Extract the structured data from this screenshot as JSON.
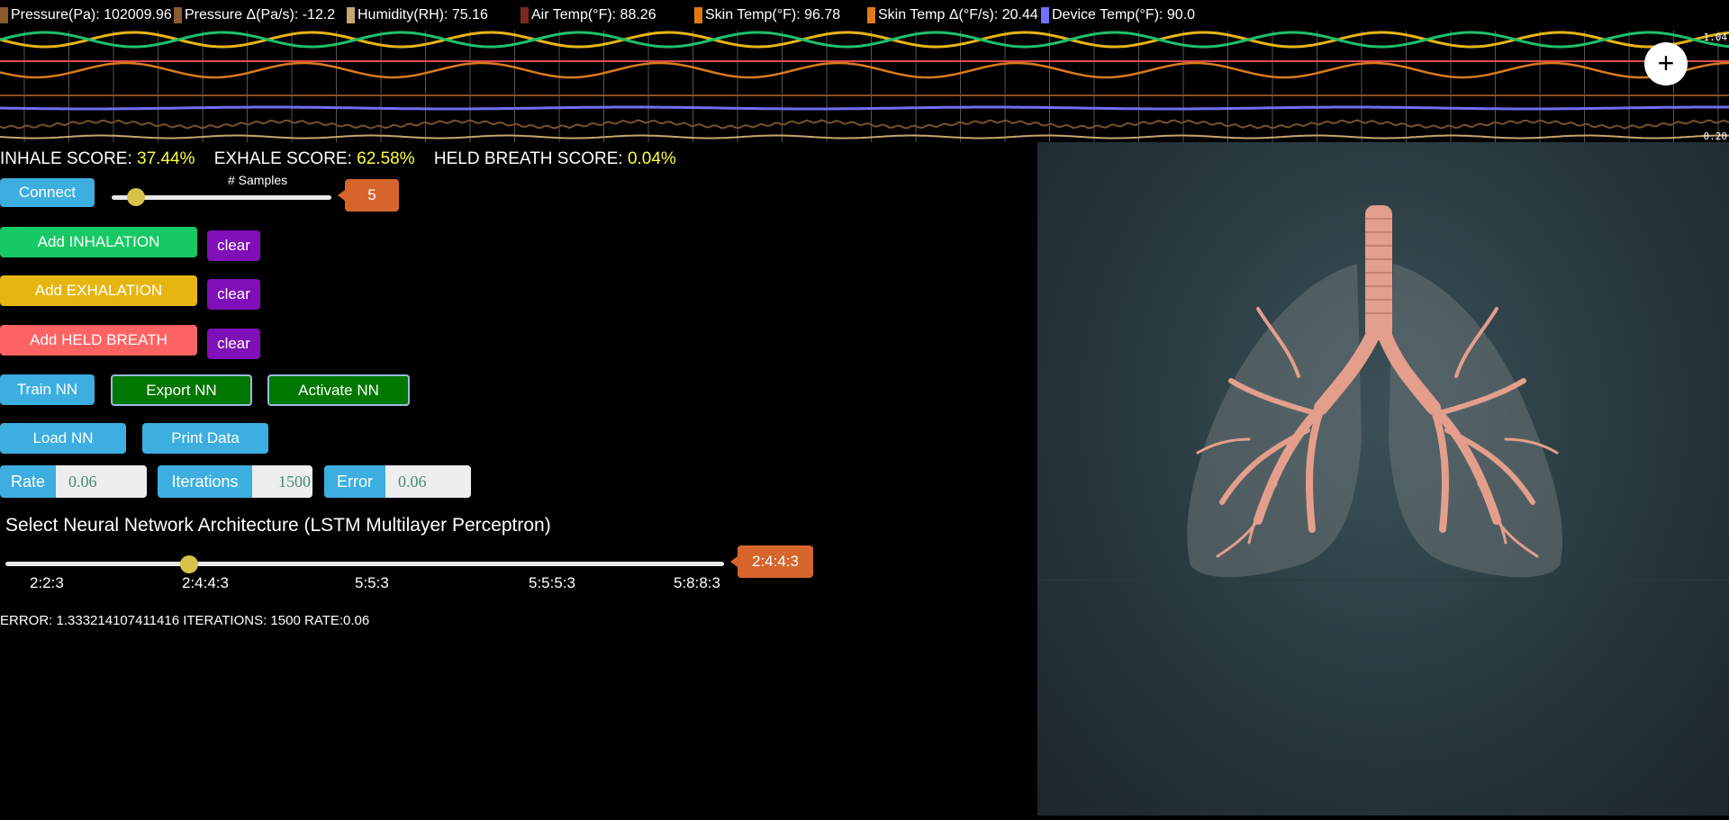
{
  "legend": [
    {
      "label": "Pressure(Pa): 102009.96",
      "color": "#8a5a2c"
    },
    {
      "label": "Pressure Δ(Pa/s): -12.2",
      "color": "#8c5a2b"
    },
    {
      "label": "Humidity(RH): 75.16",
      "color": "#c8a56e"
    },
    {
      "label": "Air Temp(°F): 88.26",
      "color": "#7a2a1a"
    },
    {
      "label": "Skin Temp(°F): 96.78",
      "color": "#e07a10"
    },
    {
      "label": "Skin Temp Δ(°F/s): 20.44",
      "color": "#e0781c"
    },
    {
      "label": "Device Temp(°F): 90.0",
      "color": "#7070ff"
    }
  ],
  "chart": {
    "ymax_label": "1.04",
    "ymin_label": "0.20"
  },
  "zoom_button": "+",
  "scores": {
    "inhale_label": "INHALE SCORE:",
    "inhale_value": "37.44%",
    "exhale_label": "EXHALE SCORE:",
    "exhale_value": "62.58%",
    "held_label": "HELD BREATH SCORE:",
    "held_value": "0.04%"
  },
  "controls": {
    "connect": "Connect",
    "samples_label": "# Samples",
    "samples_value": "5",
    "add_inhalation": "Add INHALATION",
    "add_exhalation": "Add EXHALATION",
    "add_held": "Add HELD BREATH",
    "clear": "clear",
    "train": "Train NN",
    "export": "Export NN",
    "activate": "Activate NN",
    "load": "Load NN",
    "print": "Print Data"
  },
  "params": {
    "rate_label": "Rate",
    "rate_value": "0.06",
    "iterations_label": "Iterations",
    "iterations_value": "1500",
    "error_label": "Error",
    "error_value": "0.06"
  },
  "architecture": {
    "title": "Select Neural Network Architecture (LSTM Multilayer Perceptron)",
    "options": [
      "2:2:3",
      "2:4:4:3",
      "5:5:3",
      "5:5:5:3",
      "5:8:8:3"
    ],
    "selected": "2:4:4:3"
  },
  "status": "ERROR: 1.333214107411416 ITERATIONS: 1500 RATE:0.06"
}
